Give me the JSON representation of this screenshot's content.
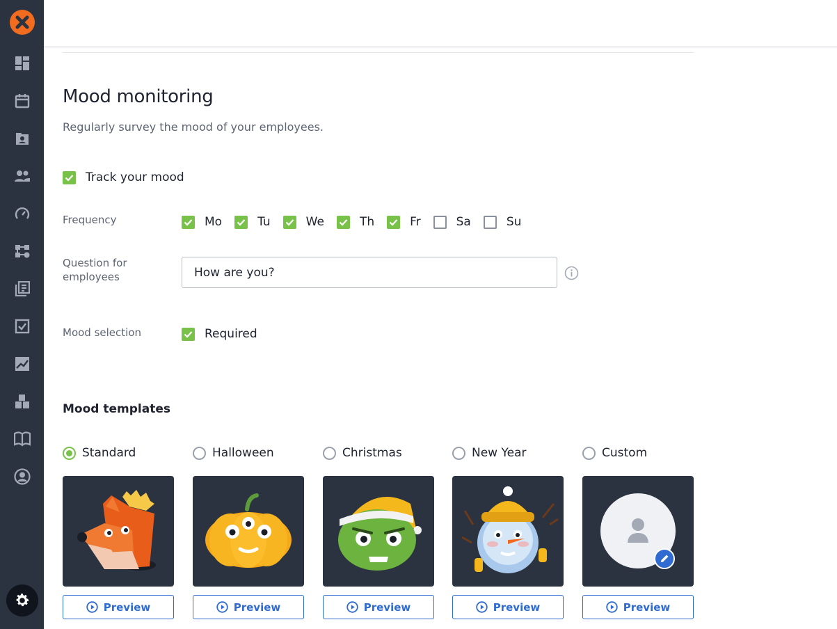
{
  "header": {
    "title": "Mood monitoring",
    "subtitle": "Regularly survey the mood of your employees."
  },
  "track": {
    "label": "Track your mood",
    "checked": true
  },
  "frequency": {
    "label": "Frequency",
    "days": [
      {
        "label": "Mo",
        "checked": true
      },
      {
        "label": "Tu",
        "checked": true
      },
      {
        "label": "We",
        "checked": true
      },
      {
        "label": "Th",
        "checked": true
      },
      {
        "label": "Fr",
        "checked": true
      },
      {
        "label": "Sa",
        "checked": false
      },
      {
        "label": "Su",
        "checked": false
      }
    ]
  },
  "question": {
    "label": "Question for employees",
    "value": "How are you?"
  },
  "mood_selection": {
    "label": "Mood selection",
    "option": "Required",
    "checked": true
  },
  "templates": {
    "title": "Mood templates",
    "preview_label": "Preview",
    "items": [
      {
        "label": "Standard",
        "selected": true
      },
      {
        "label": "Halloween",
        "selected": false
      },
      {
        "label": "Christmas",
        "selected": false
      },
      {
        "label": "New Year",
        "selected": false
      },
      {
        "label": "Custom",
        "selected": false
      }
    ]
  },
  "colors": {
    "sidebar": "#2b3240",
    "accent": "#79c24a",
    "link": "#2f6bd0",
    "logo": "#f26c1f"
  }
}
